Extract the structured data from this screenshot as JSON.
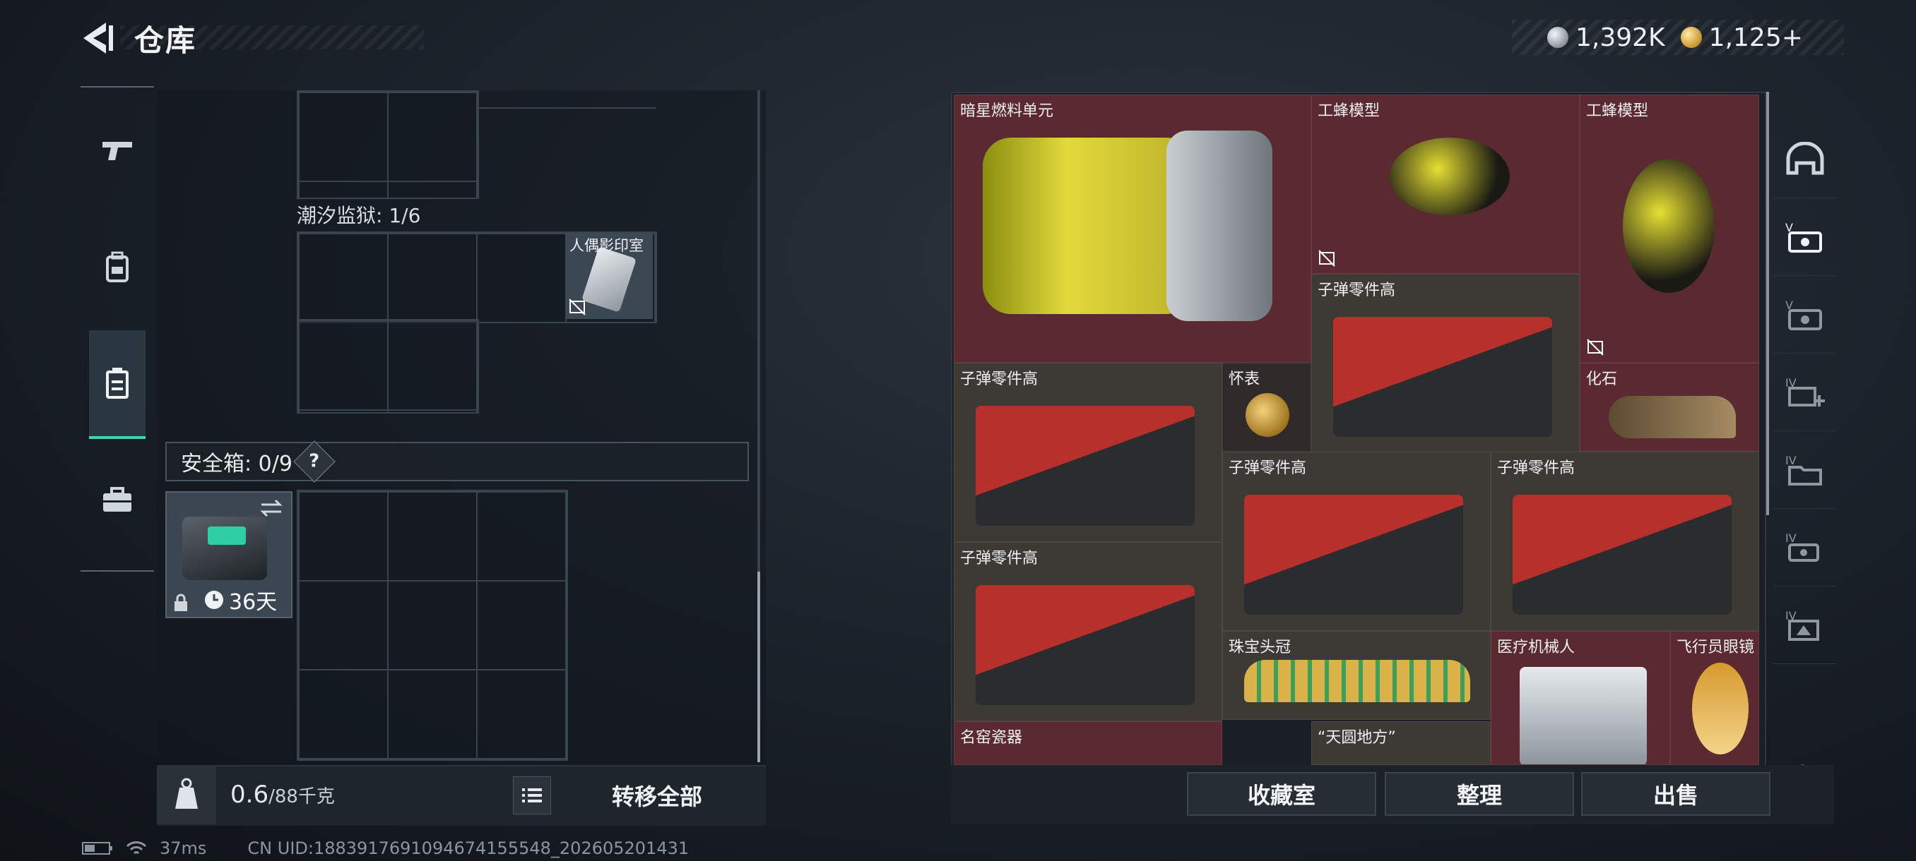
{
  "header": {
    "title": "仓库"
  },
  "currency": {
    "silver": "1,392K",
    "gold": "1,125+"
  },
  "left": {
    "section_label": "潮汐监狱: 1/6",
    "item_label": "人偶影印室",
    "safe_label": "安全箱: 0/9",
    "help": "?",
    "safebox_days": "36天"
  },
  "bottom_left": {
    "weight": "0.6",
    "weight_unit": "/88千克",
    "transfer_all": "转移全部"
  },
  "items": [
    "暗星燃料单元",
    "工蜂模型",
    "工蜂模型",
    "子弹零件高",
    "子弹零件高",
    "怀表",
    "化石",
    "子弹零件高",
    "子弹零件高",
    "子弹零件高",
    "珠宝头冠",
    "医疗机械人",
    "飞行员眼镜",
    "名窑瓷器",
    "“天圆地方”"
  ],
  "buttons": {
    "collection": "收藏室",
    "organize": "整理",
    "sell": "出售"
  },
  "status": {
    "ping": "37ms",
    "uid": "CN UID:1883917691094674155548_202605201431"
  },
  "colors": {
    "accent": "#3fd6b8",
    "item_red": "#5a2a30"
  }
}
